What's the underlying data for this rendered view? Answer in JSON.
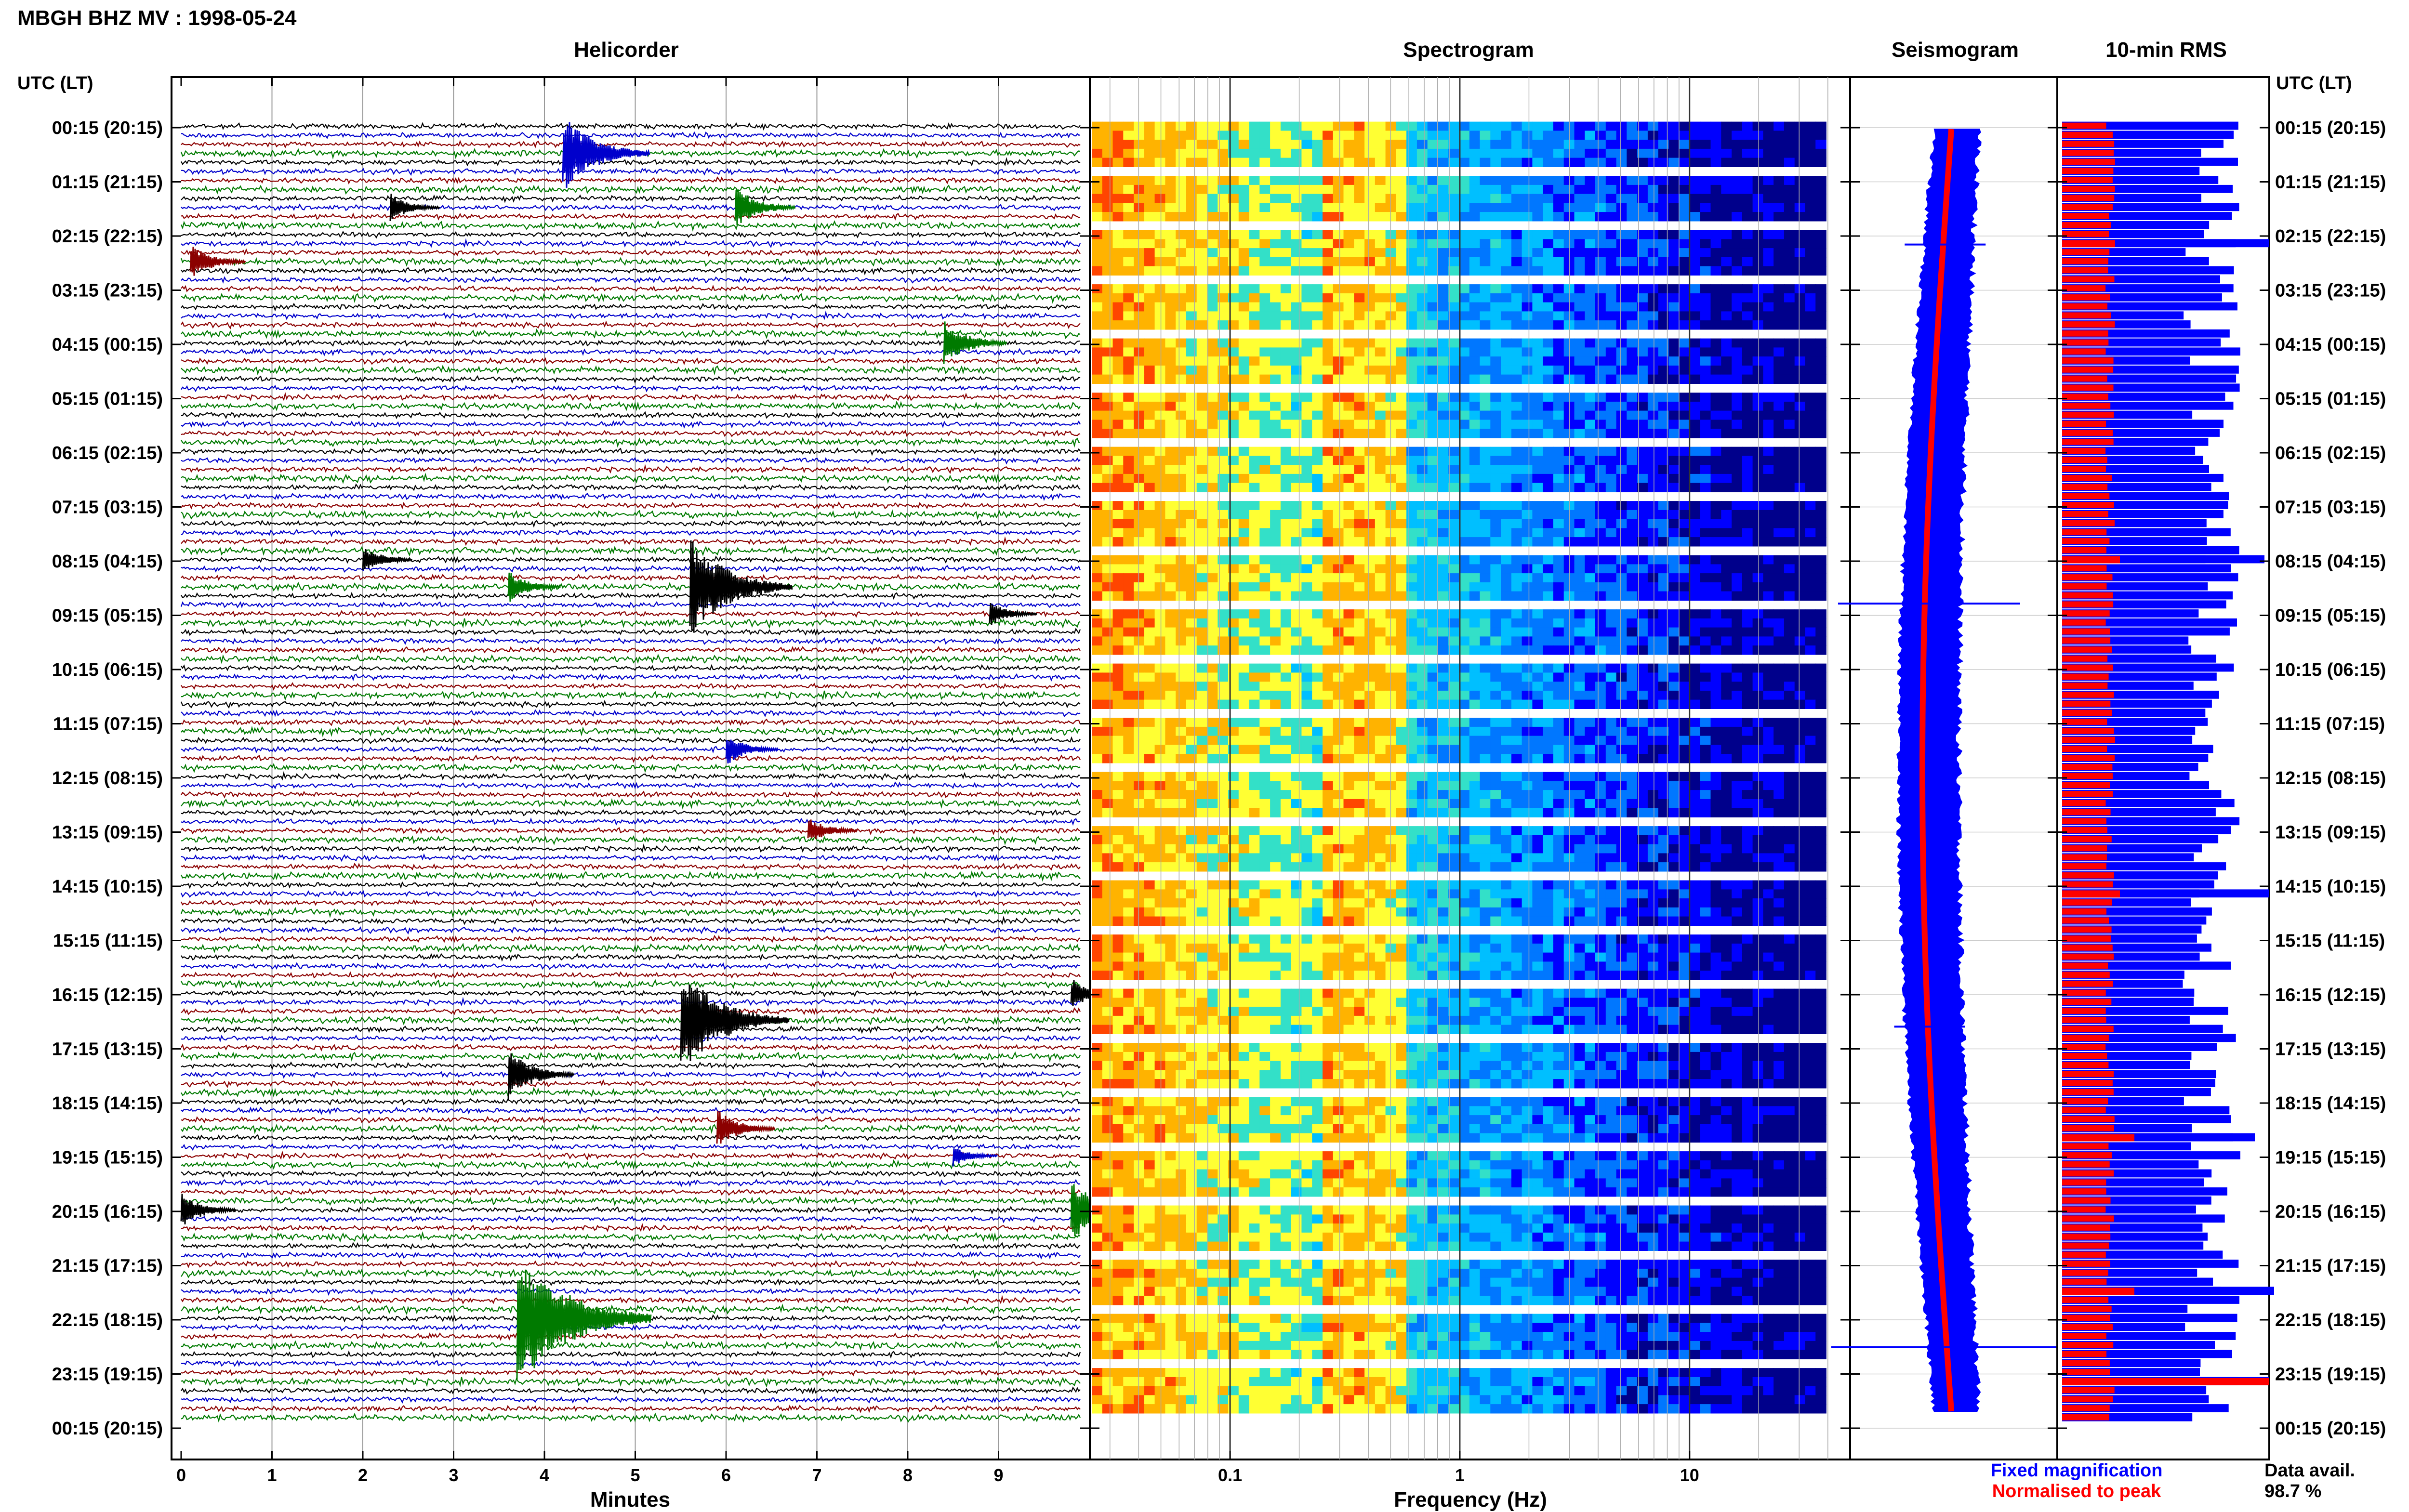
{
  "header": {
    "title": "MBGH BHZ MV : 1998-05-24"
  },
  "chart_data": [
    {
      "type": "line",
      "panel": "helicorder",
      "title": "Helicorder",
      "xlabel": "Minutes",
      "ylabel": "UTC (LT)",
      "right_ylabel": "UTC (LT)",
      "xlim": [
        0,
        10
      ],
      "x_ticks": [
        "0",
        "1",
        "2",
        "3",
        "4",
        "5",
        "6",
        "7",
        "8",
        "9"
      ],
      "y_ticks": [
        "00:15 (20:15)",
        "01:15 (21:15)",
        "02:15 (22:15)",
        "03:15 (23:15)",
        "04:15 (00:15)",
        "05:15 (01:15)",
        "06:15 (02:15)",
        "07:15 (03:15)",
        "08:15 (04:15)",
        "09:15 (05:15)",
        "10:15 (06:15)",
        "11:15 (07:15)",
        "12:15 (08:15)",
        "13:15 (09:15)",
        "14:15 (10:15)",
        "15:15 (11:15)",
        "16:15 (12:15)",
        "17:15 (13:15)",
        "18:15 (14:15)",
        "19:15 (15:15)",
        "20:15 (16:15)",
        "21:15 (17:15)",
        "22:15 (18:15)",
        "23:15 (19:15)",
        "00:15 (20:15)"
      ],
      "trace_colors": [
        "#000000",
        "#0000cc",
        "#8b0000",
        "#007a00"
      ],
      "events": [
        {
          "row": 1,
          "minute": 4.2,
          "amp": 2.2,
          "color": "#0000cc"
        },
        {
          "row": 3,
          "minute": 2.3,
          "amp": 0.8,
          "color": "#000000"
        },
        {
          "row": 3,
          "minute": 6.1,
          "amp": 1.2,
          "color": "#007a00"
        },
        {
          "row": 5,
          "minute": 0.1,
          "amp": 1.0,
          "color": "#8b0000"
        },
        {
          "row": 8,
          "minute": 8.4,
          "amp": 1.3,
          "color": "#007a00"
        },
        {
          "row": 16,
          "minute": 2.0,
          "amp": 0.8,
          "color": "#000000"
        },
        {
          "row": 17,
          "minute": 3.6,
          "amp": 0.9,
          "color": "#007a00"
        },
        {
          "row": 17,
          "minute": 5.6,
          "amp": 2.8,
          "color": "#000000"
        },
        {
          "row": 18,
          "minute": 8.9,
          "amp": 0.7,
          "color": "#000000"
        },
        {
          "row": 23,
          "minute": 6.0,
          "amp": 0.9,
          "color": "#0000cc"
        },
        {
          "row": 26,
          "minute": 6.9,
          "amp": 0.8,
          "color": "#8b0000"
        },
        {
          "row": 32,
          "minute": 9.8,
          "amp": 0.9,
          "color": "#000000"
        },
        {
          "row": 33,
          "minute": 5.5,
          "amp": 3.0,
          "color": "#000000"
        },
        {
          "row": 35,
          "minute": 3.6,
          "amp": 1.4,
          "color": "#000000"
        },
        {
          "row": 37,
          "minute": 5.9,
          "amp": 1.1,
          "color": "#8b0000"
        },
        {
          "row": 38,
          "minute": 8.5,
          "amp": 0.6,
          "color": "#0000cc"
        },
        {
          "row": 40,
          "minute": 0.0,
          "amp": 1.0,
          "color": "#000000"
        },
        {
          "row": 40,
          "minute": 9.8,
          "amp": 1.8,
          "color": "#007a00"
        },
        {
          "row": 44,
          "minute": 3.7,
          "amp": 4.0,
          "color": "#007a00"
        }
      ]
    },
    {
      "type": "heatmap",
      "panel": "spectrogram",
      "title": "Spectrogram",
      "xlabel": "Frequency (Hz)",
      "x_scale": "log",
      "xlim": [
        0.025,
        50
      ],
      "x_ticks": [
        "0.1",
        "1",
        "10"
      ],
      "colormap": [
        "#00008b",
        "#0000ff",
        "#0077ff",
        "#00bfff",
        "#33e0c8",
        "#ffff33",
        "#ffb300",
        "#ff4500",
        "#b00000"
      ]
    },
    {
      "type": "line",
      "panel": "seismogram",
      "title": "Seismogram"
    },
    {
      "type": "bar",
      "panel": "rms",
      "title": "10-min RMS",
      "series": [
        {
          "name": "Fixed magnification",
          "color": "#0000ff"
        },
        {
          "name": "Normalised to peak",
          "color": "#ff0000"
        }
      ]
    }
  ],
  "footer": {
    "legend_fixed": "Fixed magnification",
    "legend_norm": "Normalised to peak",
    "data_avail_label": "Data avail.",
    "data_avail_value": "98.7 %"
  },
  "colors": {
    "fixed": "#0000ff",
    "norm": "#ff0000",
    "gap": "#ffffff"
  }
}
